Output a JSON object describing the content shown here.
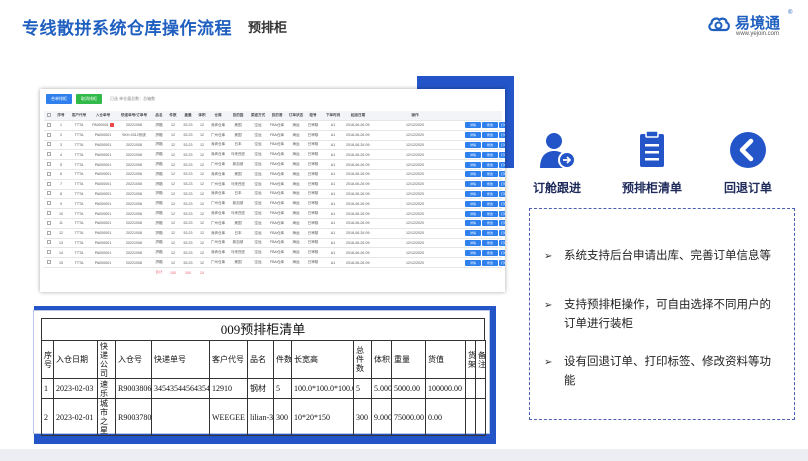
{
  "header": {
    "title": "专线散拼系统仓库操作流程",
    "subtitle": "预排柜",
    "logo_text": "易境通",
    "logo_url": "www.yejoin.com",
    "logo_reg": "®"
  },
  "colors": {
    "brand_blue": "#1f5fbf",
    "accent_blue": "#2355c8",
    "navy": "#1e2a5a"
  },
  "screenshot1": {
    "toolbar": {
      "btn1": "合单排柜",
      "btn2": "取消排柜",
      "hint": "已选  单仓量总数：总箱数"
    },
    "headers": [
      "",
      "序号",
      "客户代号",
      "入仓单号",
      "快递单号/订单号",
      "品名",
      "件数",
      "重量",
      "体积",
      "仓库",
      "目的国",
      "渠道方式",
      "目的港",
      "订单状态",
      "柜号",
      "下单时间",
      "起运日期",
      "操作"
    ],
    "rows": [
      [
        "1",
        "TTTA",
        "PA000001",
        "20221008",
        "拼箱",
        "12",
        "53.23",
        "12",
        "深圳仓库",
        "美国",
        "空运",
        "FBA仓库",
        "海运",
        "已审核",
        "A1",
        "2018-06-26 09:10:05",
        "12/12/2020"
      ],
      [
        "2",
        "TTTA",
        "PA000001",
        "SKH-0312系统",
        "拼箱",
        "12",
        "53.23",
        "12",
        "广州仓库",
        "美国",
        "空运",
        "FBA仓库",
        "海运",
        "已审核",
        "A1",
        "2018-06-26 09:10:05",
        "12/12/2020"
      ],
      [
        "3",
        "TTTA",
        "PA000001",
        "20221008",
        "拼箱",
        "12",
        "53.23",
        "12",
        "深圳仓库",
        "日本",
        "空运",
        "FBA仓库",
        "海运",
        "已审核",
        "A1",
        "2018-06-26 09:10:05",
        "12/12/2020"
      ],
      [
        "4",
        "TTTA",
        "PA000001",
        "20221008",
        "拼箱",
        "12",
        "53.23",
        "12",
        "深圳仓库",
        "马来西亚",
        "空运",
        "FBA仓库",
        "海运",
        "已审核",
        "A1",
        "2018-06-26 09:10:05",
        "12/12/2020"
      ],
      [
        "5",
        "TTTA",
        "PA000001",
        "20221008",
        "拼箱",
        "12",
        "53.23",
        "12",
        "广州仓库",
        "新加坡",
        "空运",
        "FBA仓库",
        "海运",
        "已审核",
        "A1",
        "2018-06-26 09:10:05",
        "12/12/2020"
      ],
      [
        "6",
        "TTTA",
        "PA000001",
        "20221008",
        "拼箱",
        "12",
        "53.23",
        "12",
        "深圳仓库",
        "美国",
        "空运",
        "FBA仓库",
        "海运",
        "已审核",
        "A1",
        "2018-06-26 09:10:05",
        "12/12/2020"
      ],
      [
        "7",
        "TTTA",
        "PA000001",
        "20221008",
        "拼箱",
        "12",
        "53.23",
        "12",
        "广州仓库",
        "马来西亚",
        "空运",
        "FBA仓库",
        "海运",
        "已审核",
        "A1",
        "2018-06-26 09:10:05",
        "12/12/2020"
      ],
      [
        "8",
        "TTTA",
        "PA000001",
        "20221008",
        "拼箱",
        "12",
        "53.23",
        "12",
        "深圳仓库",
        "日本",
        "空运",
        "FBA仓库",
        "海运",
        "已审核",
        "A1",
        "2018-06-26 09:10:05",
        "12/12/2020"
      ],
      [
        "9",
        "TTTA",
        "PA000001",
        "20221008",
        "拼箱",
        "12",
        "53.23",
        "12",
        "广州仓库",
        "新加坡",
        "空运",
        "FBA仓库",
        "海运",
        "已审核",
        "A1",
        "2018-06-26 09:10:05",
        "12/12/2020"
      ],
      [
        "10",
        "TTTA",
        "PA000001",
        "20221008",
        "拼箱",
        "12",
        "53.23",
        "12",
        "深圳仓库",
        "马来西亚",
        "空运",
        "FBA仓库",
        "海运",
        "已审核",
        "A1",
        "2018-06-26 09:10:05",
        "12/12/2020"
      ],
      [
        "11",
        "TTTA",
        "PA000001",
        "20221008",
        "拼箱",
        "12",
        "53.23",
        "12",
        "广州仓库",
        "美国",
        "空运",
        "FBA仓库",
        "海运",
        "已审核",
        "A1",
        "2018-06-26 09:10:05",
        "12/12/2020"
      ],
      [
        "12",
        "TTTA",
        "PA000001",
        "20221008",
        "拼箱",
        "12",
        "53.23",
        "12",
        "深圳仓库",
        "日本",
        "空运",
        "FBA仓库",
        "海运",
        "已审核",
        "A1",
        "2018-06-26 09:10:05",
        "12/12/2020"
      ],
      [
        "13",
        "TTTA",
        "PA000001",
        "20221008",
        "拼箱",
        "12",
        "53.23",
        "12",
        "广州仓库",
        "新加坡",
        "空运",
        "FBA仓库",
        "海运",
        "已审核",
        "A1",
        "2018-06-26 09:10:05",
        "12/12/2020"
      ],
      [
        "14",
        "TTTA",
        "PA000001",
        "20221008",
        "拼箱",
        "12",
        "53.23",
        "12",
        "深圳仓库",
        "马来西亚",
        "空运",
        "FBA仓库",
        "海运",
        "已审核",
        "A1",
        "2018-06-26 09:10:05",
        "12/12/2020"
      ],
      [
        "15",
        "TTTA",
        "PA000001",
        "20221008",
        "拼箱",
        "12",
        "53.23",
        "12",
        "广州仓库",
        "美国",
        "空运",
        "FBA仓库",
        "海运",
        "已审核",
        "A1",
        "2018-06-26 09:10:05",
        "12/12/2020"
      ]
    ],
    "ops": [
      "详情",
      "修改",
      "打印标签",
      "打印预报单",
      "回退"
    ],
    "sum": [
      "合计",
      "100",
      "100",
      "24"
    ]
  },
  "screenshot2": {
    "title": "009预排柜清单",
    "headers": [
      "序号",
      "入仓日期",
      "快递公司",
      "入仓号",
      "快递单号",
      "客户代号",
      "品名",
      "件数",
      "长宽高",
      "总件数",
      "体积",
      "重量",
      "货值",
      "货架",
      "备注"
    ],
    "rows": [
      [
        "1",
        "2023-02-03",
        "速乐",
        "R9003806",
        "345435445643546",
        "12910",
        "钢材",
        "5",
        "100.0*100.0*100.0",
        "5",
        "5.000",
        "5000.00",
        "100000.00",
        "",
        ""
      ],
      [
        "2",
        "2023-02-01",
        "城市之星",
        "R9003780",
        "",
        "WEEGEE",
        "lilian-3",
        "300",
        "10*20*150",
        "300",
        "9.000",
        "75000.00",
        "0.00",
        "",
        ""
      ]
    ]
  },
  "actions": [
    {
      "label": "订舱跟进",
      "icon": "user-forward-icon"
    },
    {
      "label": "预排柜清单",
      "icon": "clipboard-list-icon"
    },
    {
      "label": "回退订单",
      "icon": "back-arrow-icon"
    }
  ],
  "features": [
    {
      "arrow": "➢",
      "text": "系统支持后台申请出库、完善订单信息等"
    },
    {
      "arrow": "➢",
      "text": "支持预排柜操作，可自由选择不同用户的订单进行装柜"
    },
    {
      "arrow": "➢",
      "text": "设有回退订单、打印标签、修改资料等功能"
    }
  ]
}
